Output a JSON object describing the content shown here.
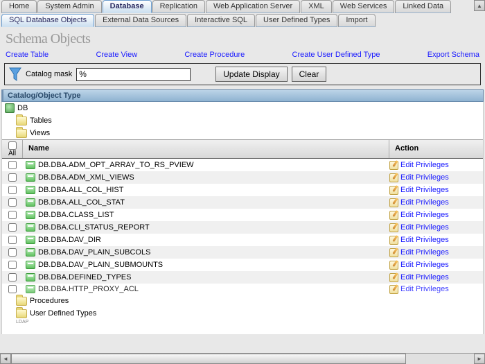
{
  "tabs_primary": [
    {
      "label": "Home",
      "active": false
    },
    {
      "label": "System Admin",
      "active": false
    },
    {
      "label": "Database",
      "active": true
    },
    {
      "label": "Replication",
      "active": false
    },
    {
      "label": "Web Application Server",
      "active": false
    },
    {
      "label": "XML",
      "active": false
    },
    {
      "label": "Web Services",
      "active": false
    },
    {
      "label": "Linked Data",
      "active": false
    }
  ],
  "tabs_secondary": [
    {
      "label": "SQL Database Objects",
      "active": true
    },
    {
      "label": "External Data Sources",
      "active": false
    },
    {
      "label": "Interactive SQL",
      "active": false
    },
    {
      "label": "User Defined Types",
      "active": false
    },
    {
      "label": "Import",
      "active": false
    }
  ],
  "page_title": "Schema Objects",
  "action_links": {
    "create_table": "Create Table",
    "create_view": "Create View",
    "create_procedure": "Create Procedure",
    "create_udt": "Create User Defined Type",
    "export_schema": "Export Schema"
  },
  "filter": {
    "label": "Catalog mask",
    "value": "%",
    "update_btn": "Update Display",
    "clear_btn": "Clear"
  },
  "catalog_header": "Catalog/Object Type",
  "tree": {
    "root": "DB",
    "tables": "Tables",
    "views": "Views",
    "procedures": "Procedures",
    "udt": "User Defined Types",
    "ldap": "LDAP"
  },
  "grid": {
    "all": "All",
    "name": "Name",
    "action": "Action",
    "edit": "Edit Privileges",
    "rows": [
      "DB.DBA.ADM_OPT_ARRAY_TO_RS_PVIEW",
      "DB.DBA.ADM_XML_VIEWS",
      "DB.DBA.ALL_COL_HIST",
      "DB.DBA.ALL_COL_STAT",
      "DB.DBA.CLASS_LIST",
      "DB.DBA.CLI_STATUS_REPORT",
      "DB.DBA.DAV_DIR",
      "DB.DBA.DAV_PLAIN_SUBCOLS",
      "DB.DBA.DAV_PLAIN_SUBMOUNTS",
      "DB.DBA.DEFINED_TYPES",
      "DB.DBA.HTTP_PROXY_ACL"
    ]
  }
}
